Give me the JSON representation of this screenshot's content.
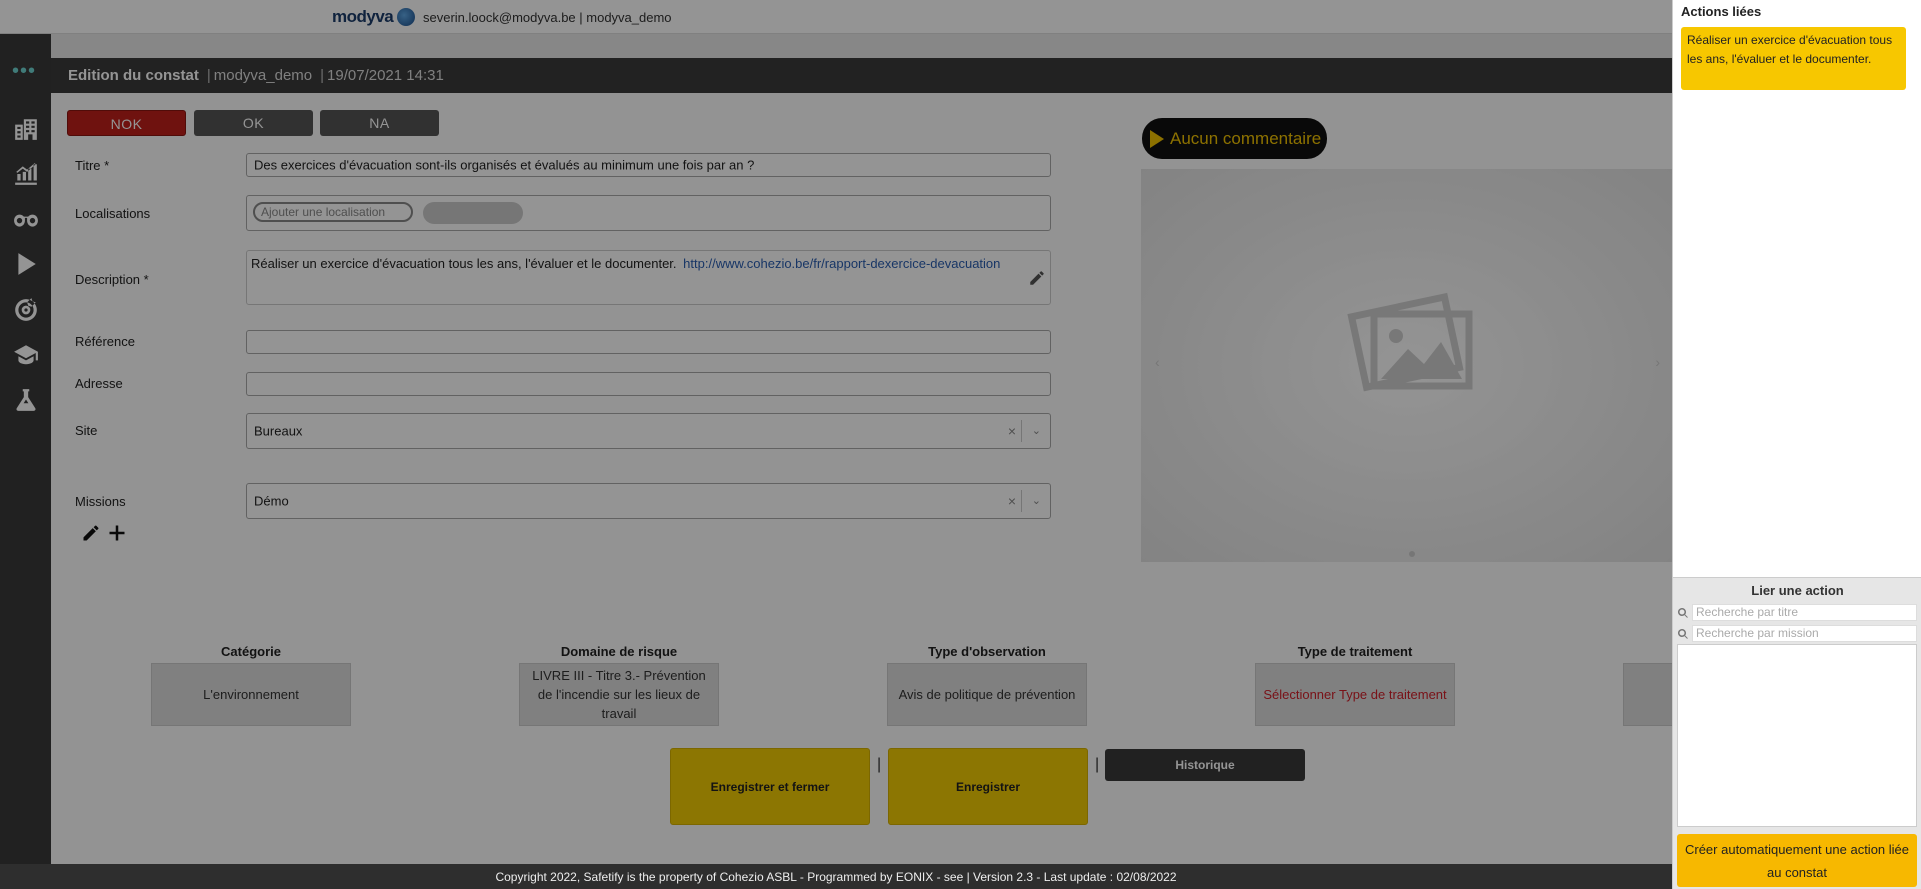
{
  "topbar": {
    "logo": "modyva",
    "user": "severin.loock@modyva.be | modyva_demo"
  },
  "sidebar": {
    "icons": [
      "menu-dots-icon",
      "buildings-icon",
      "chart-growth-icon",
      "binoculars-icon",
      "play-icon",
      "target-icon",
      "graduation-cap-icon",
      "flask-icon"
    ]
  },
  "header": {
    "title": "Edition du constat",
    "org": "modyva_demo",
    "datetime": "19/07/2021 14:31"
  },
  "status_buttons": {
    "nok": "NOK",
    "ok": "OK",
    "na": "NA"
  },
  "form": {
    "titre_label": "Titre *",
    "titre_value": "Des exercices d'évacuation sont-ils organisés et évalués au minimum une fois par an ?",
    "localisations_label": "Localisations",
    "localisation_placeholder": "Ajouter une localisation",
    "description_label": "Description *",
    "description_text": "Réaliser un exercice d'évacuation tous les ans, l'évaluer et le documenter.",
    "description_link": "http://www.cohezio.be/fr/rapport-dexercice-devacuation",
    "reference_label": "Référence",
    "adresse_label": "Adresse",
    "site_label": "Site",
    "site_value": "Bureaux",
    "missions_label": "Missions",
    "missions_value": "Démo"
  },
  "comment": {
    "label": "Aucun commentaire"
  },
  "categories": [
    {
      "title": "Catégorie",
      "value": "L'environnement"
    },
    {
      "title": "Domaine de risque",
      "value": "LIVRE III - Titre 3.- Prévention de l'incendie sur les lieux de travail"
    },
    {
      "title": "Type d'observation",
      "value": "Avis de politique de prévention"
    },
    {
      "title": "Type de traitement",
      "value": "Sélectionner Type de traitement"
    }
  ],
  "actions": {
    "save_close": "Enregistrer et fermer",
    "save": "Enregistrer",
    "history": "Historique",
    "pipe": "|"
  },
  "footer": {
    "text": "Copyright 2022, Safetify is the property of Cohezio ASBL - Programmed by EONIX - see | Version 2.3 - Last update : 02/08/2022"
  },
  "right_panel": {
    "title": "Actions liées",
    "linked_action": "Réaliser un exercice d'évacuation tous les ans, l'évaluer et le documenter.",
    "lier_title": "Lier une action",
    "search_title_placeholder": "Recherche par titre",
    "search_mission_placeholder": "Recherche par mission",
    "create_button": "Créer automatiquement une action liée au constat"
  },
  "colors": {
    "nok": "#c0201a",
    "accent_yellow": "#f2cb05",
    "dark": "#3a3a3a",
    "link": "#2a5db0"
  }
}
